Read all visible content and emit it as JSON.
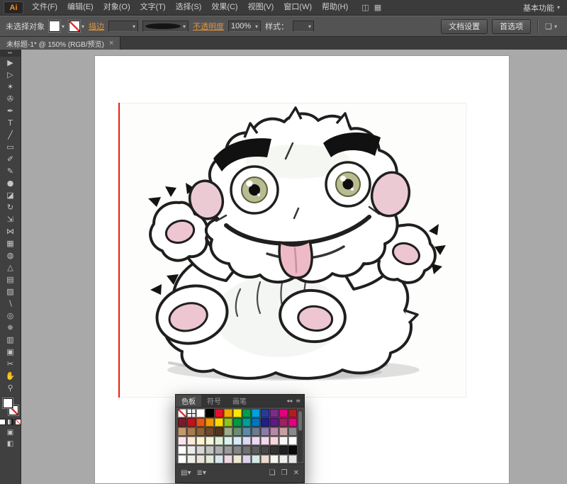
{
  "icons": {
    "app_logo": "Ai",
    "dropdown": "▾",
    "close": "×",
    "collapse": "◂◂",
    "panel_menu": "≡",
    "toolbar_expand": "▸▸"
  },
  "colors": {
    "accent_orange": "#e2943a",
    "canvas_gray": "#a9a9a9",
    "guide_red": "#f01e0e"
  },
  "menubar": {
    "items": [
      "文件(F)",
      "编辑(E)",
      "对象(O)",
      "文字(T)",
      "选择(S)",
      "效果(C)",
      "视图(V)",
      "窗口(W)",
      "帮助(H)"
    ],
    "extra_buttons": [
      {
        "name": "bridge-button",
        "glyph": "◫"
      },
      {
        "name": "arrange-documents-button",
        "glyph": "▦"
      }
    ],
    "workspace_label": "基本功能"
  },
  "controlbar": {
    "no_selection_label": "未选择对象",
    "stroke_link": "描边",
    "opacity_link": "不透明度",
    "opacity_value": "100%",
    "style_label": "样式：",
    "doc_setup_button": "文档设置",
    "preferences_button": "首选项"
  },
  "tabbar": {
    "title": "未标题-1* @ 150% (RGB/预览)"
  },
  "toolbar": {
    "tools": [
      {
        "name": "selection-tool",
        "glyph": "▶"
      },
      {
        "name": "direct-selection-tool",
        "glyph": "▷"
      },
      {
        "name": "magic-wand-tool",
        "glyph": "✶"
      },
      {
        "name": "lasso-tool",
        "glyph": "✇"
      },
      {
        "name": "pen-tool",
        "glyph": "✒"
      },
      {
        "name": "type-tool",
        "glyph": "T"
      },
      {
        "name": "line-segment-tool",
        "glyph": "╱"
      },
      {
        "name": "rectangle-tool",
        "glyph": "▭"
      },
      {
        "name": "paintbrush-tool",
        "glyph": "✐"
      },
      {
        "name": "pencil-tool",
        "glyph": "✎"
      },
      {
        "name": "blob-brush-tool",
        "glyph": "●"
      },
      {
        "name": "eraser-tool",
        "glyph": "◪"
      },
      {
        "name": "rotate-tool",
        "glyph": "↻"
      },
      {
        "name": "scale-tool",
        "glyph": "⇲"
      },
      {
        "name": "width-tool",
        "glyph": "⋈"
      },
      {
        "name": "free-transform-tool",
        "glyph": "▦"
      },
      {
        "name": "shape-builder-tool",
        "glyph": "◍"
      },
      {
        "name": "perspective-grid-tool",
        "glyph": "△"
      },
      {
        "name": "mesh-tool",
        "glyph": "▤"
      },
      {
        "name": "gradient-tool",
        "glyph": "▨"
      },
      {
        "name": "eyedropper-tool",
        "glyph": "∖"
      },
      {
        "name": "blend-tool",
        "glyph": "◎"
      },
      {
        "name": "symbol-sprayer-tool",
        "glyph": "✵"
      },
      {
        "name": "column-graph-tool",
        "glyph": "▥"
      },
      {
        "name": "artboard-tool",
        "glyph": "▣"
      },
      {
        "name": "slice-tool",
        "glyph": "✂"
      },
      {
        "name": "hand-tool",
        "glyph": "✋"
      },
      {
        "name": "zoom-tool",
        "glyph": "⚲"
      }
    ]
  },
  "panel": {
    "tabs": [
      "色板",
      "符号",
      "画笔"
    ],
    "swatches": [
      "none",
      "reg",
      "#ffffff",
      "#000000",
      "#e8112d",
      "#f6a800",
      "#ffe600",
      "#009e49",
      "#00a0dd",
      "#283a97",
      "#7d2b8b",
      "#e3007f",
      "#b01e23",
      "#7a1c28",
      "#c1121f",
      "#e95513",
      "#f39800",
      "#ffd900",
      "#8fc31f",
      "#009944",
      "#009e96",
      "#0075c2",
      "#1d2088",
      "#601986",
      "#9f1f63",
      "#e4007f",
      "#c49a6c",
      "#a87c4f",
      "#8c6239",
      "#6f4a2a",
      "#54351c",
      "#9cad88",
      "#6a8d73",
      "#5a8ca8",
      "#6d7b8d",
      "#8d7ba8",
      "#b58aa5",
      "#c9a0a0",
      "#8a8a8a",
      "#fce4ec",
      "#fde9d9",
      "#fff3cd",
      "#f3f7d9",
      "#e2f0d9",
      "#d9f2ec",
      "#d9eaf7",
      "#dcd9f2",
      "#ecd9f2",
      "#f2d9ea",
      "#f8d7da",
      "#f7f7f7",
      "#ffffff",
      "#ffffff",
      "#ebebeb",
      "#d6d6d6",
      "#c2c2c2",
      "#adadad",
      "#999999",
      "#858585",
      "#707070",
      "#5c5c5c",
      "#474747",
      "#333333",
      "#1f1f1f",
      "#0a0a0a",
      "#ffffff",
      "#f2efe9",
      "#e9e4d8",
      "#e0ecd8",
      "#d8e6ec",
      "#ecd8e2",
      "#eee8d0",
      "#ddd4ec",
      "#d2ece4",
      "#ecdcd0",
      "#f7f7f2",
      "#efefef",
      "#e6e6e6"
    ],
    "footer_buttons": [
      {
        "name": "swatch-libraries-button",
        "glyph": "▤▾"
      },
      {
        "name": "swatch-kinds-button",
        "glyph": "≣▾"
      },
      {
        "name": "new-color-group-button",
        "glyph": "❏"
      },
      {
        "name": "new-swatch-button",
        "glyph": "❐"
      },
      {
        "name": "delete-swatch-button",
        "glyph": "✕"
      }
    ]
  }
}
